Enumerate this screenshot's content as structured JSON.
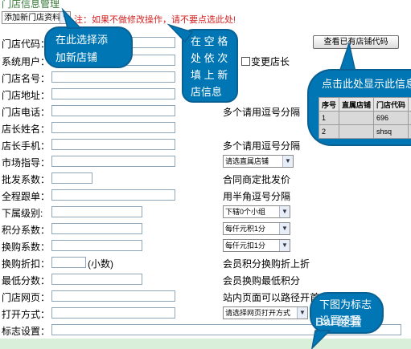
{
  "page": {
    "title": "门店信息管理",
    "action_select": "添加新门店资料",
    "warning": "注：如果不做修改操作，请不要点选此处!",
    "view_button": "查看已有店铺代码"
  },
  "form": {
    "code_label": "门店代码：",
    "user_label": "系统用户：",
    "change_manager": "变更店长",
    "name_label": "门店名号：",
    "address_label": "门店地址：",
    "phone_label": "门店电话：",
    "phone_hint": "多个请用逗号分隔",
    "manager_name_label": "店长姓名：",
    "manager_mobile_label": "店长手机：",
    "mobile_hint": "多个请用逗号分隔",
    "market_label": "市场指导：",
    "market_select": "请选直属店铺",
    "wholesale_label": "批发系数：",
    "wholesale_hint": "合同商定批发价",
    "tracking_label": "全程跟单：",
    "tracking_hint": "用半角逗号分隔",
    "subordinate_label": "下属级别:",
    "subordinate_select": "下辖0个小组",
    "points_label": "积分系数：",
    "points_select": "每仟元积1分",
    "exchange_label": "换购系数：",
    "exchange_select": "每仟元扣1分",
    "discount_label": "换购折扣：",
    "discount_unit": "(小数)",
    "discount_hint": "会员积分换购折上折",
    "min_points_label": "最低分数：",
    "min_points_hint": "会员换购最低积分",
    "web_label": "门店网页：",
    "web_hint": "站内页面可以路径开首,例: /...",
    "open_label": "打开方式：",
    "open_select": "请选择网页打开方式",
    "logo_label": "标志设置："
  },
  "callouts": {
    "select_add": [
      "在此选择添",
      "加新店铺"
    ],
    "fill_info": [
      "在 空 格",
      "处 依 次",
      "填 上 新",
      "店信息"
    ],
    "show_info": "点击此处显示此信息",
    "logo_note": [
      "下图为标志",
      "设置设置"
    ]
  },
  "mini_table": {
    "headers": [
      "序号",
      "直属店铺",
      "门店代码",
      "门"
    ],
    "rows": [
      [
        "1",
        "",
        "696",
        "po"
      ],
      [
        "2",
        "",
        "shsq",
        "sh"
      ]
    ]
  },
  "watermark": "Bai 经验"
}
